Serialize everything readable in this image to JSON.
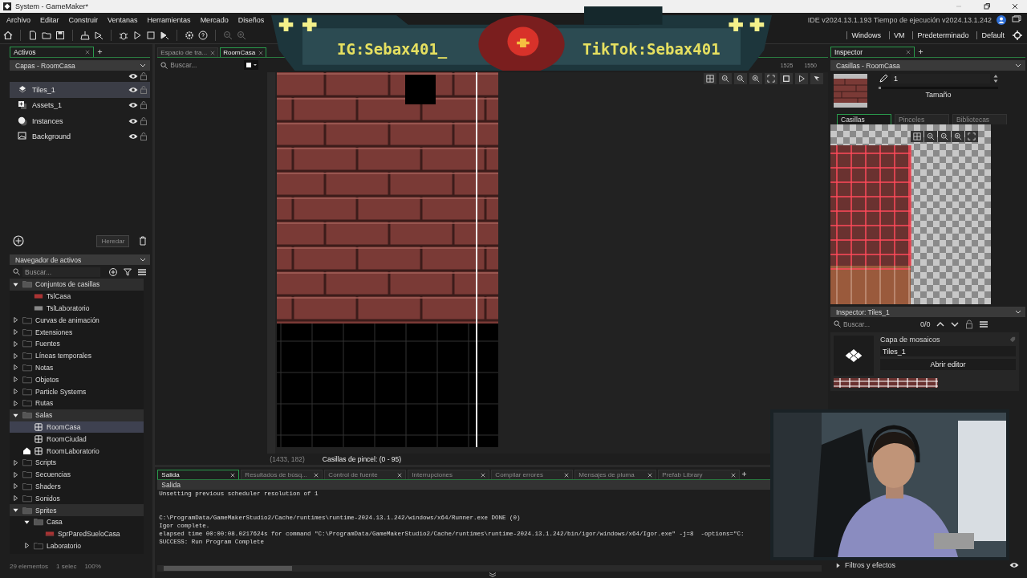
{
  "window": {
    "title": "System - GameMaker*"
  },
  "menu": [
    "Archivo",
    "Editar",
    "Construir",
    "Ventanas",
    "Herramientas",
    "Mercado",
    "Diseños"
  ],
  "version_info": "IDE v2024.13.1.193  Tiempo de ejecución v2024.13.1.242",
  "targets": [
    "Windows",
    "VM",
    "Predeterminado",
    "Default"
  ],
  "overlay": {
    "left_text": "IG:Sebax401_",
    "right_text": "TikTok:Sebax401"
  },
  "layers_panel": {
    "tab": "Activos",
    "dropdown": "Capas - RoomCasa",
    "inherit_button": "Heredar",
    "layers": [
      {
        "name": "Tiles_1",
        "kind": "tiles",
        "selected": true
      },
      {
        "name": "Assets_1",
        "kind": "assets",
        "selected": false
      },
      {
        "name": "Instances",
        "kind": "instances",
        "selected": false
      },
      {
        "name": "Background",
        "kind": "background",
        "selected": false
      }
    ]
  },
  "asset_browser": {
    "title": "Navegador de activos",
    "search_placeholder": "Buscar...",
    "footer": [
      "29 elementos",
      "1 selec",
      "100%"
    ],
    "tree": [
      {
        "label": "Conjuntos de casillas",
        "kind": "folder",
        "expanded": true,
        "selected": false,
        "children": [
          {
            "label": "TslCasa",
            "kind": "tileset",
            "selected": false
          },
          {
            "label": "TslLaboratorio",
            "kind": "tileset",
            "selected": false
          }
        ]
      },
      {
        "label": "Curvas de animación",
        "kind": "folder",
        "expanded": false,
        "selected": false
      },
      {
        "label": "Extensiones",
        "kind": "folder",
        "expanded": false,
        "selected": false
      },
      {
        "label": "Fuentes",
        "kind": "folder",
        "expanded": false,
        "selected": false
      },
      {
        "label": "Líneas temporales",
        "kind": "folder",
        "expanded": false,
        "selected": false
      },
      {
        "label": "Notas",
        "kind": "folder",
        "expanded": false,
        "selected": false
      },
      {
        "label": "Objetos",
        "kind": "folder",
        "expanded": false,
        "selected": false
      },
      {
        "label": "Particle Systems",
        "kind": "folder",
        "expanded": false,
        "selected": false
      },
      {
        "label": "Rutas",
        "kind": "folder",
        "expanded": false,
        "selected": false
      },
      {
        "label": "Salas",
        "kind": "folder",
        "expanded": true,
        "selected": false,
        "children": [
          {
            "label": "RoomCasa",
            "kind": "room",
            "selected": true
          },
          {
            "label": "RoomCiudad",
            "kind": "room",
            "selected": false
          },
          {
            "label": "RoomLaboratorio",
            "kind": "start_room",
            "selected": false
          }
        ]
      },
      {
        "label": "Scripts",
        "kind": "folder",
        "expanded": false,
        "selected": false
      },
      {
        "label": "Secuencias",
        "kind": "folder",
        "expanded": false,
        "selected": false
      },
      {
        "label": "Shaders",
        "kind": "folder",
        "expanded": false,
        "selected": false
      },
      {
        "label": "Sonidos",
        "kind": "folder",
        "expanded": false,
        "selected": false
      },
      {
        "label": "Sprites",
        "kind": "folder",
        "expanded": true,
        "selected": false,
        "children": [
          {
            "label": "Casa",
            "kind": "folder",
            "expanded": true,
            "selected": false,
            "children": [
              {
                "label": "SprParedSueloCasa",
                "kind": "sprite",
                "selected": false
              }
            ]
          },
          {
            "label": "Laboratorio",
            "kind": "folder",
            "expanded": false,
            "selected": false
          }
        ]
      }
    ]
  },
  "room_editor": {
    "tabs": [
      {
        "label": "Espacio de tra...",
        "selected": false
      },
      {
        "label": "RoomCasa",
        "selected": true
      }
    ],
    "search_placeholder": "Buscar...",
    "ruler_labels": [
      "1525",
      "1550"
    ],
    "cursor": "(1433, 182)",
    "brush_tiles": "Casillas de pincel: (0 - 95)"
  },
  "output": {
    "tabs": [
      {
        "label": "Salida",
        "selected": true
      },
      {
        "label": "Resultados de búsq...",
        "selected": false
      },
      {
        "label": "Control de fuente",
        "selected": false
      },
      {
        "label": "Interrupciones",
        "selected": false
      },
      {
        "label": "Compilar errores",
        "selected": false
      },
      {
        "label": "Mensajes de pluma",
        "selected": false
      },
      {
        "label": "Prefab Library",
        "selected": false
      }
    ],
    "header": "Salida",
    "lines": [
      {
        "text": "Unsetting previous scheduler resolution of 1",
        "spaced": false
      },
      {
        "text": "C:\\ProgramData/GameMakerStudio2/Cache/runtimes\\runtime-2024.13.1.242/windows/x64/Runner.exe DONE (0)",
        "spaced": true
      },
      {
        "text": "Igor complete.",
        "spaced": false
      },
      {
        "text": "elapsed time 00:00:08.0217624s for command \"C:\\ProgramData/GameMakerStudio2/Cache/runtimes\\runtime-2024.13.1.242/bin/igor/windows/x64/Igor.exe\" -j=8  -options=\"C:",
        "spaced": false
      },
      {
        "text": "SUCCESS: Run Program Complete",
        "spaced": false
      }
    ]
  },
  "inspector": {
    "tab": "Inspector",
    "dropdown": "Casillas - RoomCasa",
    "brush_size": "1",
    "size_label": "Tamaño",
    "size_slider": {
      "level": 0.02
    },
    "tabs": [
      {
        "label": "Casillas",
        "selected": true,
        "disabled": false
      },
      {
        "label": "Pinceles",
        "selected": false,
        "disabled": true
      },
      {
        "label": "Bibliotecas",
        "selected": false,
        "disabled": true
      }
    ],
    "properties_title": "Inspector: Tiles_1",
    "search_placeholder": "Buscar...",
    "match_count": "0/0",
    "layer_type": "Capa de mosaicos",
    "layer_name": "Tiles_1",
    "open_editor": "Abrir editor",
    "filters": "Filtros y efectos"
  }
}
